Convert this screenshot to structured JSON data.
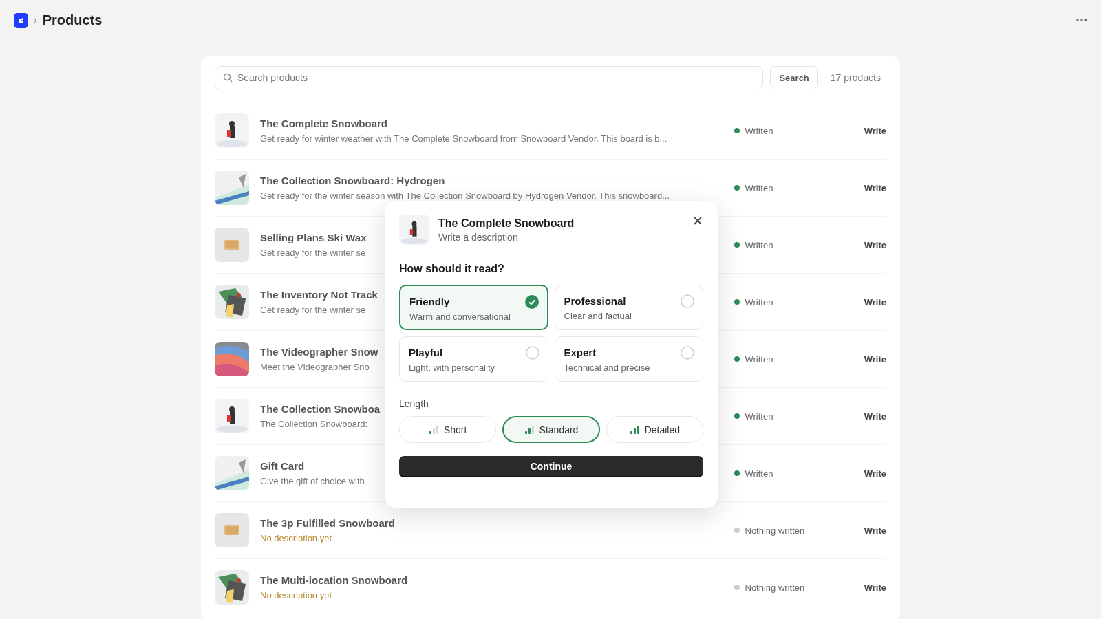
{
  "header": {
    "separator": "›",
    "title": "Products"
  },
  "search": {
    "placeholder": "Search products",
    "button": "Search",
    "count": "17 products"
  },
  "products": [
    {
      "title": "The Complete Snowboard",
      "description": "Get ready for winter weather with The Complete Snowboard from Snowboard Vendor. This board is b...",
      "written": true,
      "status": "Written",
      "action": "Write"
    },
    {
      "title": "The Collection Snowboard: Hydrogen",
      "description": "Get ready for the winter season with The Collection Snowboard by Hydrogen Vendor. This snowboard...",
      "written": true,
      "status": "Written",
      "action": "Write"
    },
    {
      "title": "Selling Plans Ski Wax",
      "description": "Get ready for the winter se",
      "written": true,
      "status": "Written",
      "action": "Write"
    },
    {
      "title": "The Inventory Not Track",
      "description": "Get ready for the winter se",
      "written": true,
      "status": "Written",
      "action": "Write"
    },
    {
      "title": "The Videographer Snow",
      "description": "Meet the Videographer Sno",
      "written": true,
      "status": "Written",
      "action": "Write"
    },
    {
      "title": "The Collection Snowboa",
      "description": "The Collection Snowboard:",
      "written": true,
      "status": "Written",
      "action": "Write"
    },
    {
      "title": "Gift Card",
      "description": "Give the gift of choice with",
      "written": true,
      "status": "Written",
      "action": "Write"
    },
    {
      "title": "The 3p Fulfilled Snowboard",
      "description": "No description yet",
      "written": false,
      "status": "Nothing written",
      "action": "Write"
    },
    {
      "title": "The Multi-location Snowboard",
      "description": "No description yet",
      "written": false,
      "status": "Nothing written",
      "action": "Write"
    }
  ],
  "dialog": {
    "title": "The Complete Snowboard",
    "subtitle": "Write a description",
    "question": "How should it read?",
    "tones": [
      {
        "label": "Friendly",
        "hint": "Warm and conversational",
        "selected": true
      },
      {
        "label": "Professional",
        "hint": "Clear and factual",
        "selected": false
      },
      {
        "label": "Playful",
        "hint": "Light, with personality",
        "selected": false
      },
      {
        "label": "Expert",
        "hint": "Technical and precise",
        "selected": false
      }
    ],
    "length_label": "Length",
    "lengths": [
      {
        "label": "Short",
        "level": 0.33,
        "selected": false
      },
      {
        "label": "Standard",
        "level": 0.67,
        "selected": true
      },
      {
        "label": "Detailed",
        "level": 1,
        "selected": false
      }
    ],
    "continue": "Continue"
  }
}
